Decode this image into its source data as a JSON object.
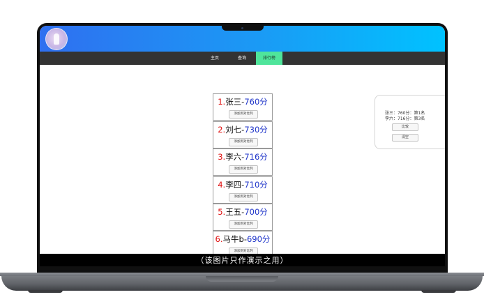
{
  "nav": {
    "items": [
      {
        "label": "主页",
        "active": false
      },
      {
        "label": "查询",
        "active": false
      },
      {
        "label": "排行榜",
        "active": true
      }
    ]
  },
  "ranking": [
    {
      "num": "1.",
      "name": "张三-",
      "score": "760分",
      "button": "添加到对比列"
    },
    {
      "num": "2.",
      "name": "刘七-",
      "score": "730分",
      "button": "添加到对比列"
    },
    {
      "num": "3.",
      "name": "李六-",
      "score": "716分",
      "button": "添加到对比列"
    },
    {
      "num": "4.",
      "name": "李四-",
      "score": "710分",
      "button": "添加到对比列"
    },
    {
      "num": "5.",
      "name": "王五-",
      "score": "700分",
      "button": "添加到对比列"
    },
    {
      "num": "6.",
      "name": "马牛b-",
      "score": "690分",
      "button": "添加到对比列"
    }
  ],
  "compare": {
    "lines": [
      "张三：760分：第1名",
      "李六：716分：第3名"
    ],
    "compare_button": "比较",
    "clear_button": "清空"
  },
  "overlay_text": "（该图片只作演示之用）",
  "colors": {
    "header_start": "#2f6ff0",
    "header_end": "#00c2ff",
    "active_tab": "#4fe59b",
    "rank_number": "#e01010",
    "score": "#1d33c9"
  }
}
